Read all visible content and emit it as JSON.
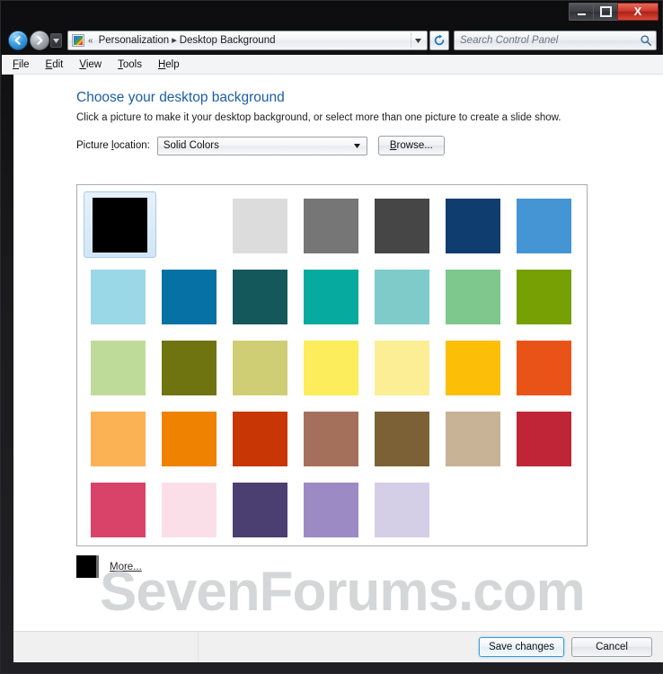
{
  "window": {
    "controls": {
      "minimize": "—",
      "maximize": "□",
      "close": "X"
    }
  },
  "navbar": {
    "back_icon": "back-arrow-icon",
    "forward_icon": "forward-arrow-icon",
    "history_caret": "chevron-down-icon",
    "address_icon": "personalization-icon",
    "breadcrumb_chevron": "«",
    "breadcrumbs": [
      {
        "label": "Personalization"
      },
      {
        "label": "Desktop Background"
      }
    ],
    "separator": "▸",
    "address_caret": "chevron-down-icon",
    "refresh_icon": "refresh-icon",
    "search": {
      "placeholder": "Search Control Panel",
      "value": "",
      "icon": "search-icon"
    }
  },
  "menubar": {
    "items": [
      {
        "accesskey": "F",
        "rest": "ile"
      },
      {
        "accesskey": "E",
        "rest": "dit"
      },
      {
        "accesskey": "V",
        "rest": "iew"
      },
      {
        "accesskey": "T",
        "rest": "ools"
      },
      {
        "accesskey": "H",
        "rest": "elp"
      }
    ]
  },
  "page": {
    "heading": "Choose your desktop background",
    "subtitle": "Click a picture to make it your desktop background, or select more than one picture to create a slide show.",
    "location_label_accesskey": "l",
    "location_label_pre": "Picture ",
    "location_label_post": "ocation:",
    "location_value": "Solid Colors",
    "location_options": [
      "Solid Colors"
    ],
    "location_caret": "chevron-down-icon",
    "browse_accesskey": "B",
    "browse_rest": "rowse...",
    "more_label": "More...",
    "more_chip_color": "#000000",
    "watermark": "SevenForums.com"
  },
  "swatches": {
    "selected_index": 0,
    "rows": [
      [
        {
          "name": "black",
          "color": "#000000",
          "selected": true
        },
        {
          "name": "white",
          "color": "#ffffff",
          "selected": false
        },
        {
          "name": "light-gray",
          "color": "#dcdcdc",
          "selected": false
        },
        {
          "name": "medium-gray",
          "color": "#767676",
          "selected": false
        },
        {
          "name": "dark-gray",
          "color": "#464646",
          "selected": false
        },
        {
          "name": "navy-blue",
          "color": "#0f3d70",
          "selected": false
        },
        {
          "name": "sky-blue",
          "color": "#4594d3",
          "selected": false
        }
      ],
      [
        {
          "name": "pale-cyan",
          "color": "#9ad8e8",
          "selected": false
        },
        {
          "name": "ocean-blue",
          "color": "#0571a4",
          "selected": false
        },
        {
          "name": "deep-teal",
          "color": "#14585c",
          "selected": false
        },
        {
          "name": "turquoise",
          "color": "#06aa9e",
          "selected": false
        },
        {
          "name": "soft-teal",
          "color": "#7ecbca",
          "selected": false
        },
        {
          "name": "mint-green",
          "color": "#7ec88d",
          "selected": false
        },
        {
          "name": "olive-green",
          "color": "#76a004",
          "selected": false
        }
      ],
      [
        {
          "name": "light-green",
          "color": "#bedb9a",
          "selected": false
        },
        {
          "name": "dark-olive",
          "color": "#6f7410",
          "selected": false
        },
        {
          "name": "khaki",
          "color": "#cfce75",
          "selected": false
        },
        {
          "name": "bright-yellow",
          "color": "#fced5c",
          "selected": false
        },
        {
          "name": "pale-yellow",
          "color": "#fbee94",
          "selected": false
        },
        {
          "name": "golden-yellow",
          "color": "#fcbe06",
          "selected": false
        },
        {
          "name": "orange-red",
          "color": "#ea5318",
          "selected": false
        }
      ],
      [
        {
          "name": "light-orange",
          "color": "#fbb254",
          "selected": false
        },
        {
          "name": "pumpkin-orange",
          "color": "#ef8200",
          "selected": false
        },
        {
          "name": "burnt-orange",
          "color": "#c83605",
          "selected": false
        },
        {
          "name": "clay-brown",
          "color": "#a4705c",
          "selected": false
        },
        {
          "name": "dark-brown",
          "color": "#7d6136",
          "selected": false
        },
        {
          "name": "tan",
          "color": "#c9b396",
          "selected": false
        },
        {
          "name": "crimson",
          "color": "#bf2437",
          "selected": false
        }
      ],
      [
        {
          "name": "rose-pink",
          "color": "#d9436a",
          "selected": false
        },
        {
          "name": "pale-pink",
          "color": "#fbdfe8",
          "selected": false
        },
        {
          "name": "deep-purple",
          "color": "#4b3f72",
          "selected": false
        },
        {
          "name": "medium-purple",
          "color": "#9c8ac4",
          "selected": false
        },
        {
          "name": "lavender",
          "color": "#d4cfe6",
          "selected": false
        }
      ]
    ]
  },
  "commandbar": {
    "save_label": "Save changes",
    "cancel_label": "Cancel"
  },
  "colors": {
    "heading_blue": "#1b5ea6",
    "accent_blue": "#3c9bd4",
    "watermark_gray": "#d4d6d8"
  }
}
